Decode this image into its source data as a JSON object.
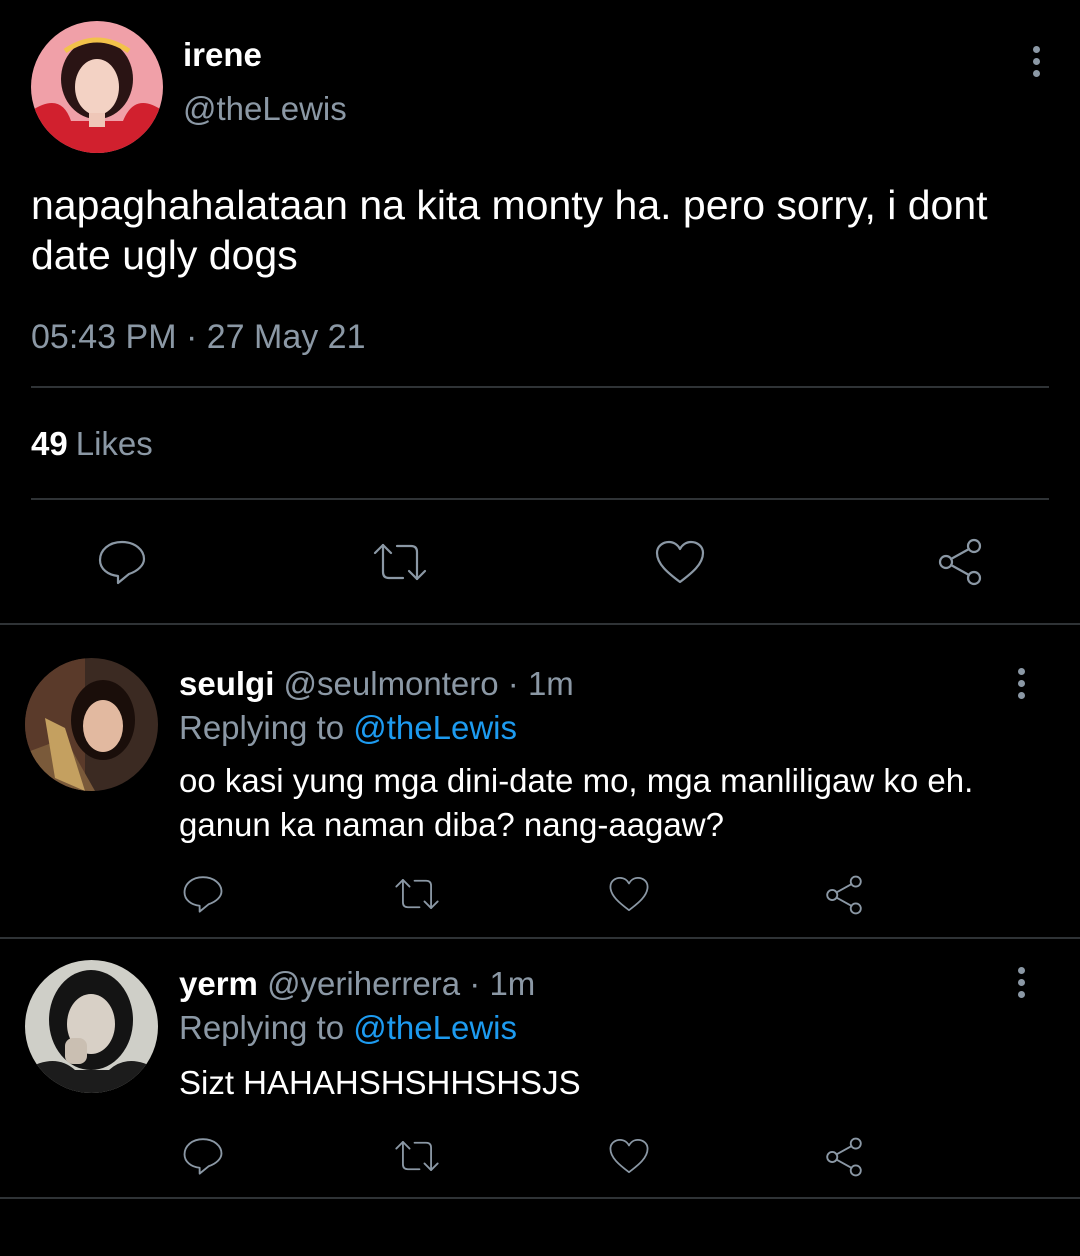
{
  "main_tweet": {
    "author_name": "irene",
    "author_handle": "@theLewis",
    "text": "napaghahalataan na kita monty ha. pero sorry, i dont date ugly dogs",
    "timestamp": "05:43 PM · 27 May 21",
    "likes_count": "49",
    "likes_label": "Likes",
    "actions": [
      "reply-icon",
      "retweet-icon",
      "like-icon",
      "share-icon"
    ]
  },
  "replies": [
    {
      "author_name": "seulgi",
      "meta": "@seulmontero · 1m",
      "replying_prefix": "Replying to ",
      "replying_mention": "@theLewis",
      "text": "oo kasi yung mga dini-date mo, mga manliligaw ko eh. ganun ka naman diba? nang-aagaw?"
    },
    {
      "author_name": "yerm",
      "meta": "@yeriherrera · 1m",
      "replying_prefix": "Replying to ",
      "replying_mention": "@theLewis",
      "text": "Sizt HAHAHSHSHHSHSJS"
    }
  ],
  "colors": {
    "background": "#000000",
    "text_primary": "#ffffff",
    "text_secondary": "#8b98a5",
    "mention": "#1d9bf0",
    "divider": "#2f3336"
  }
}
